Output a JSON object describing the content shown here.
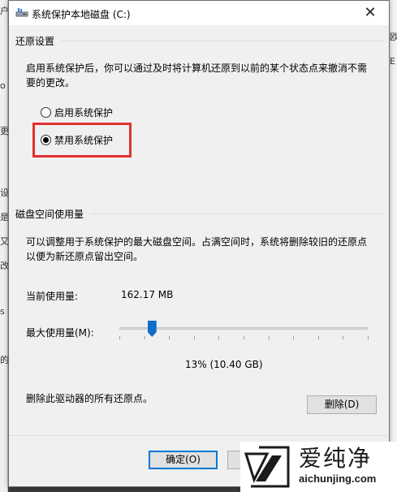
{
  "window": {
    "title": "系统保护本地磁盘 (C:)",
    "close_glyph": "✕"
  },
  "background": {
    "left_chars": [
      "户",
      "o",
      "更",
      "设",
      "是",
      "又",
      "改",
      "s",
      "的"
    ],
    "right_chars": [
      "欧",
      "E"
    ]
  },
  "restore_settings": {
    "heading": "还原设置",
    "description_line1": "启用系统保护后，你可以通过及时将计算机还原到以前的某个状态点来撤消不需",
    "description_line2": "要的更改。",
    "options": [
      {
        "label": "启用系统保护",
        "selected": false
      },
      {
        "label": "禁用系统保护",
        "selected": true
      }
    ]
  },
  "disk_space": {
    "heading": "磁盘空间使用量",
    "description_line1": "可以调整用于系统保护的最大磁盘空间。占满空间时，系统将删除较旧的还原点",
    "description_line2": "以便为新还原点留出空间。",
    "current_usage_label": "当前使用量:",
    "current_usage_value": "162.17 MB",
    "max_usage_label": "最大使用量(M):",
    "max_usage_fraction": 0.13,
    "max_usage_readout": "13% (10.40 GB)",
    "delete_description": "删除此驱动器的所有还原点。",
    "delete_button": "删除(D)"
  },
  "footer": {
    "ok_button": "确定(O)"
  },
  "watermark": {
    "brand_text": "爱纯净",
    "url": "aichunjing.com"
  },
  "colors": {
    "highlight_box": "#e0312f",
    "slider_thumb": "#0f6cc9",
    "primary_button_border": "#0078d7"
  }
}
